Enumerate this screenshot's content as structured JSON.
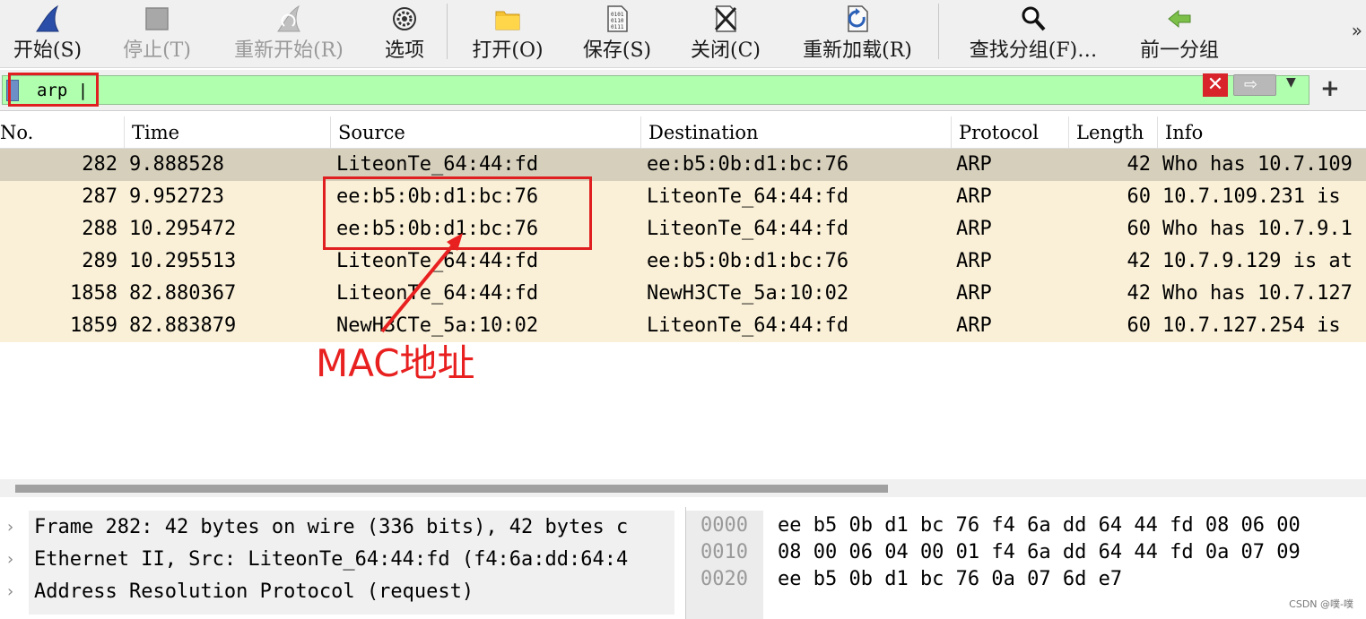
{
  "toolbar": {
    "buttons": [
      {
        "label": "开始(S)",
        "icon": "shark-fin-icon",
        "enabled": true
      },
      {
        "label": "停止(T)",
        "icon": "stop-square-icon",
        "enabled": false
      },
      {
        "label": "重新开始(R)",
        "icon": "restart-fin-icon",
        "enabled": false
      },
      {
        "label": "选项",
        "icon": "gear-icon",
        "enabled": true
      },
      {
        "label": "打开(O)",
        "icon": "folder-icon",
        "enabled": true
      },
      {
        "label": "保存(S)",
        "icon": "save-file-icon",
        "enabled": true
      },
      {
        "label": "关闭(C)",
        "icon": "close-file-icon",
        "enabled": true
      },
      {
        "label": "重新加载(R)",
        "icon": "reload-icon",
        "enabled": true
      },
      {
        "label": "查找分组(F)…",
        "icon": "magnifier-icon",
        "enabled": true
      },
      {
        "label": "前一分组",
        "icon": "back-arrow-icon",
        "enabled": true
      }
    ],
    "overflow": "»"
  },
  "filter": {
    "value": "arp",
    "clear": "✕",
    "apply": "⇨",
    "dropdown": "▼",
    "add": "+"
  },
  "packet_list": {
    "columns": [
      "No.",
      "Time",
      "Source",
      "Destination",
      "Protocol",
      "Length",
      "Info"
    ],
    "rows": [
      {
        "no": "282",
        "time": "9.888528",
        "source": "LiteonTe_64:44:fd",
        "destination": "ee:b5:0b:d1:bc:76",
        "protocol": "ARP",
        "length": "42",
        "info": "Who has 10.7.109"
      },
      {
        "no": "287",
        "time": "9.952723",
        "source": "ee:b5:0b:d1:bc:76",
        "destination": "LiteonTe_64:44:fd",
        "protocol": "ARP",
        "length": "60",
        "info": "10.7.109.231 is"
      },
      {
        "no": "288",
        "time": "10.295472",
        "source": "ee:b5:0b:d1:bc:76",
        "destination": "LiteonTe_64:44:fd",
        "protocol": "ARP",
        "length": "60",
        "info": "Who has 10.7.9.1"
      },
      {
        "no": "289",
        "time": "10.295513",
        "source": "LiteonTe_64:44:fd",
        "destination": "ee:b5:0b:d1:bc:76",
        "protocol": "ARP",
        "length": "42",
        "info": "10.7.9.129 is at"
      },
      {
        "no": "1858",
        "time": "82.880367",
        "source": "LiteonTe_64:44:fd",
        "destination": "NewH3CTe_5a:10:02",
        "protocol": "ARP",
        "length": "42",
        "info": "Who has 10.7.127"
      },
      {
        "no": "1859",
        "time": "82.883879",
        "source": "NewH3CTe_5a:10:02",
        "destination": "LiteonTe_64:44:fd",
        "protocol": "ARP",
        "length": "60",
        "info": "10.7.127.254 is"
      }
    ],
    "selected_row": 0
  },
  "details": {
    "expander": "›",
    "items": [
      "Frame 282: 42 bytes on wire (336 bits), 42 bytes c",
      "Ethernet II, Src: LiteonTe_64:44:fd (f4:6a:dd:64:4",
      "Address Resolution Protocol (request)"
    ]
  },
  "bytes": {
    "rows": [
      {
        "offset": "0000",
        "hex": "ee b5 0b d1 bc 76 f4 6a  dd 64 44 fd 08 06 00"
      },
      {
        "offset": "0010",
        "hex": "08 00 06 04 00 01 f4 6a  dd 64 44 fd 0a 07 09"
      },
      {
        "offset": "0020",
        "hex": "ee b5 0b d1 bc 76 0a 07  6d e7"
      }
    ]
  },
  "annotation": {
    "label": "MAC地址",
    "color": "#e82020"
  },
  "watermark": "CSDN @噗-噗"
}
